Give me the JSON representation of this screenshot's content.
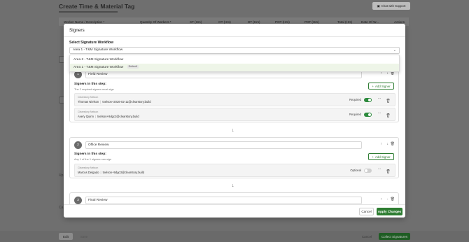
{
  "background": {
    "page_title": "Create Time & Material Tag",
    "chat_button": "Chat with Support",
    "table_headers": [
      "Worker Name / Description *",
      "Quantity Of Workers *",
      "ST (Hrs)",
      "OT (Hrs)",
      "DT (Hrs)",
      "POT (Hrs)",
      "PDT (Hrs)",
      "Total (Hrs)",
      "Date Of W...",
      "Actions"
    ],
    "left_snippets": [
      "Up",
      "Ca"
    ],
    "footer_left_label": "Edit",
    "footer_left_label2": "Save",
    "footer_right_cancel": "Cancel",
    "footer_right_primary": "Collect Signatures"
  },
  "modal": {
    "title": "Signers",
    "select_label": "Select Signature Workflow",
    "select_value": "Area 1 - T&M Signature Workflow",
    "dropdown_options": [
      {
        "label": "Area 2 - T&M Signature Workflow",
        "badge": ""
      },
      {
        "label": "Area 1 - T&M Signature Workflow",
        "badge": "Default"
      }
    ],
    "steps": [
      {
        "number": "1",
        "name": "Field Review",
        "signers_title": "Signers in this step:",
        "signers_sub": "The 2 required signers must sign",
        "add_label": "Add Signer",
        "signers": [
          {
            "company": "Clearstory Nelson",
            "name": "Thomas Nielson",
            "email": "tnelson+2026-02-11@clearstory.build",
            "status": "Required",
            "toggle_on": true
          },
          {
            "company": "Clearstory Nelson",
            "name": "Avery Quinn",
            "email": "tnelson+9dgc2@clearstory.build",
            "status": "Required",
            "toggle_on": true
          }
        ]
      },
      {
        "number": "2",
        "name": "Office Review",
        "signers_title": "Signers in this step:",
        "signers_sub": "Any 1 of the 1 signers can sign",
        "add_label": "Add Signer",
        "signers": [
          {
            "company": "Clearstory Nelson",
            "name": "Marcus Delgado",
            "email": "tnelson+9dgc3@clearstory.build",
            "status": "Optional",
            "toggle_on": false
          }
        ]
      },
      {
        "number": "3",
        "name": "Final Review"
      }
    ],
    "cancel_label": "Cancel",
    "apply_label": "Apply Changes"
  },
  "colors": {
    "accent": "#2e7d32",
    "toggle_on": "#2e8b3e",
    "dropdown_selected": "#eef5e8"
  }
}
